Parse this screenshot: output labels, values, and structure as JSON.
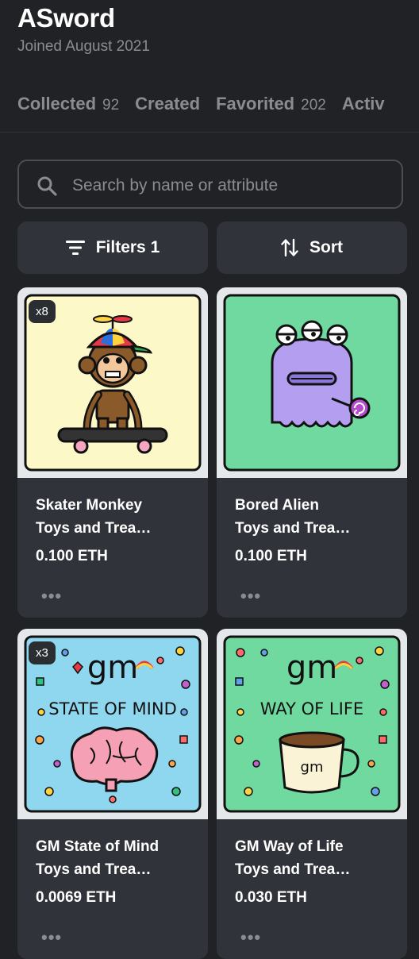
{
  "profile": {
    "name": "ASword",
    "joined": "Joined August 2021"
  },
  "tabs": [
    {
      "label": "Collected",
      "count": "92"
    },
    {
      "label": "Created",
      "count": ""
    },
    {
      "label": "Favorited",
      "count": "202"
    },
    {
      "label": "Activ",
      "count": ""
    }
  ],
  "search": {
    "placeholder": "Search by name or attribute",
    "value": ""
  },
  "toolbar": {
    "filters_label": "Filters 1",
    "sort_label": "Sort"
  },
  "cards": [
    {
      "quantity": "x8",
      "name": "Skater Monkey",
      "collection": "Toys and Trea…",
      "price": "0.100 ETH",
      "more": "•••",
      "image": "skater-monkey",
      "bg": "#fdf8c8"
    },
    {
      "quantity": "",
      "name": "Bored Alien",
      "collection": "Toys and Trea…",
      "price": "0.100 ETH",
      "more": "•••",
      "image": "bored-alien",
      "bg": "#6fd9a0"
    },
    {
      "quantity": "x3",
      "name": "GM State of Mind",
      "collection": "Toys and Trea…",
      "price": "0.0069 ETH",
      "more": "•••",
      "image": "state-of-mind",
      "image_text": "gm",
      "image_caption": "STATE OF MIND",
      "bg": "#8fd6ef"
    },
    {
      "quantity": "",
      "name": "GM Way of Life",
      "collection": "Toys and Trea…",
      "price": "0.030 ETH",
      "more": "•••",
      "image": "way-of-life",
      "image_text": "gm",
      "image_caption": "WAY OF LIFE",
      "mug_text": "gm",
      "bg": "#6fd9a0"
    }
  ]
}
